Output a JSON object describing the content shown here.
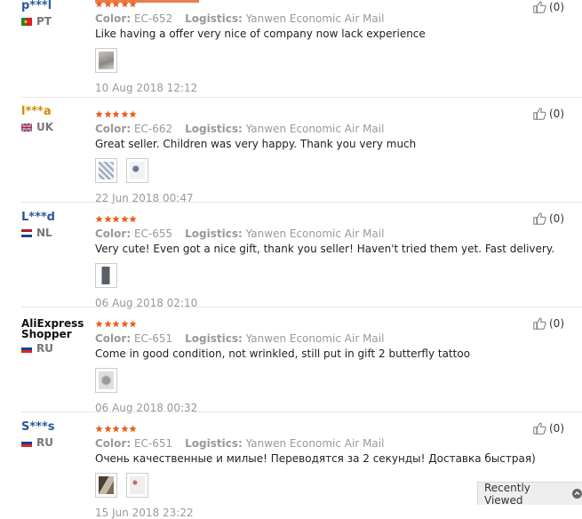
{
  "labels": {
    "color": "Color:",
    "logistics": "Logistics:"
  },
  "recently_viewed": "Recently Viewed",
  "reviews": [
    {
      "buyer": "p***l",
      "country": "PT",
      "flag_icon": "portugal-flag-icon",
      "rating": 5,
      "color": "EC-652",
      "logistics": "Yanwen Economic Air Mail",
      "comment": "Like having a offer very nice of company now lack experience",
      "photo_count": 1,
      "date": "10 Aug 2018 12:12",
      "helpful": "(0)"
    },
    {
      "buyer": "l***a",
      "country": "UK",
      "flag_icon": "uk-flag-icon",
      "rating": 5,
      "color": "EC-662",
      "logistics": "Yanwen Economic Air Mail",
      "comment": "Great seller. Children was very happy. Thank you very much",
      "photo_count": 2,
      "date": "22 Jun 2018 00:47",
      "helpful": "(0)"
    },
    {
      "buyer": "L***d",
      "country": "NL",
      "flag_icon": "netherlands-flag-icon",
      "rating": 5,
      "color": "EC-655",
      "logistics": "Yanwen Economic Air Mail",
      "comment": "Very cute! Even got a nice gift, thank you seller! Haven't tried them yet. Fast delivery.",
      "photo_count": 1,
      "date": "06 Aug 2018 02:10",
      "helpful": "(0)"
    },
    {
      "buyer": "AliExpress Shopper",
      "buyer_line1": "AliExpress",
      "buyer_line2": "Shopper",
      "country": "RU",
      "flag_icon": "russia-flag-icon",
      "rating": 5,
      "color": "EC-651",
      "logistics": "Yanwen Economic Air Mail",
      "comment": "Come in good condition, not wrinkled, still put in gift 2 butterfly tattoo",
      "photo_count": 1,
      "date": "06 Aug 2018 00:32",
      "helpful": "(0)"
    },
    {
      "buyer": "S***s",
      "country": "RU",
      "flag_icon": "russia-flag-icon",
      "rating": 5,
      "color": "EC-651",
      "logistics": "Yanwen Economic Air Mail",
      "comment": "Очень качественные и милые! Переводятся за 2 секунды! Доставка быстрая)",
      "photo_count": 2,
      "date": "15 Jun 2018 23:22",
      "helpful": "(0)"
    }
  ],
  "colors": {
    "star": "#e8611e",
    "buyer_link": "#2a5a9c",
    "accent_bar": "#e87e4b"
  }
}
